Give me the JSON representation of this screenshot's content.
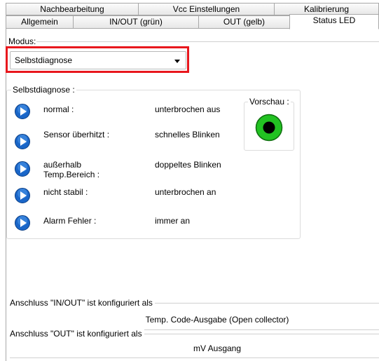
{
  "tabs_row1": [
    {
      "label": "Nachbearbeitung"
    },
    {
      "label": "Vcc Einstellungen"
    },
    {
      "label": "Kalibrierung"
    }
  ],
  "tabs_row2": [
    {
      "label": "Allgemein"
    },
    {
      "label": "IN/OUT (grün)"
    },
    {
      "label": "OUT (gelb)"
    },
    {
      "label": "Status LED",
      "active": true
    }
  ],
  "modus": {
    "label": "Modus:",
    "selected": "Selbstdiagnose"
  },
  "selbstdiagnose": {
    "title": "Selbstdiagnose :",
    "rows": [
      {
        "label": "normal :",
        "value": "unterbrochen aus",
        "icon": "play-icon"
      },
      {
        "label": "Sensor überhitzt :",
        "value": "schnelles Blinken",
        "icon": "play-icon"
      },
      {
        "label": "außerhalb Temp.Bereich :",
        "value": "doppeltes Blinken",
        "icon": "play-icon"
      },
      {
        "label": "nicht stabil :",
        "value": "unterbrochen an",
        "icon": "play-icon"
      },
      {
        "label": "Alarm Fehler :",
        "value": "immer an",
        "icon": "play-icon"
      }
    ],
    "preview": {
      "title": "Vorschau :",
      "led_color": "#22c222",
      "led_center": "#000000"
    }
  },
  "anschluss_inout": {
    "title": "Anschluss \"IN/OUT\" ist konfiguriert als",
    "value": "Temp. Code-Ausgabe (Open collector)"
  },
  "anschluss_out": {
    "title": "Anschluss \"OUT\" ist konfiguriert als",
    "value": "mV Ausgang"
  },
  "colors": {
    "highlight": "#e8171d",
    "button_blue": "#1a66c8"
  }
}
